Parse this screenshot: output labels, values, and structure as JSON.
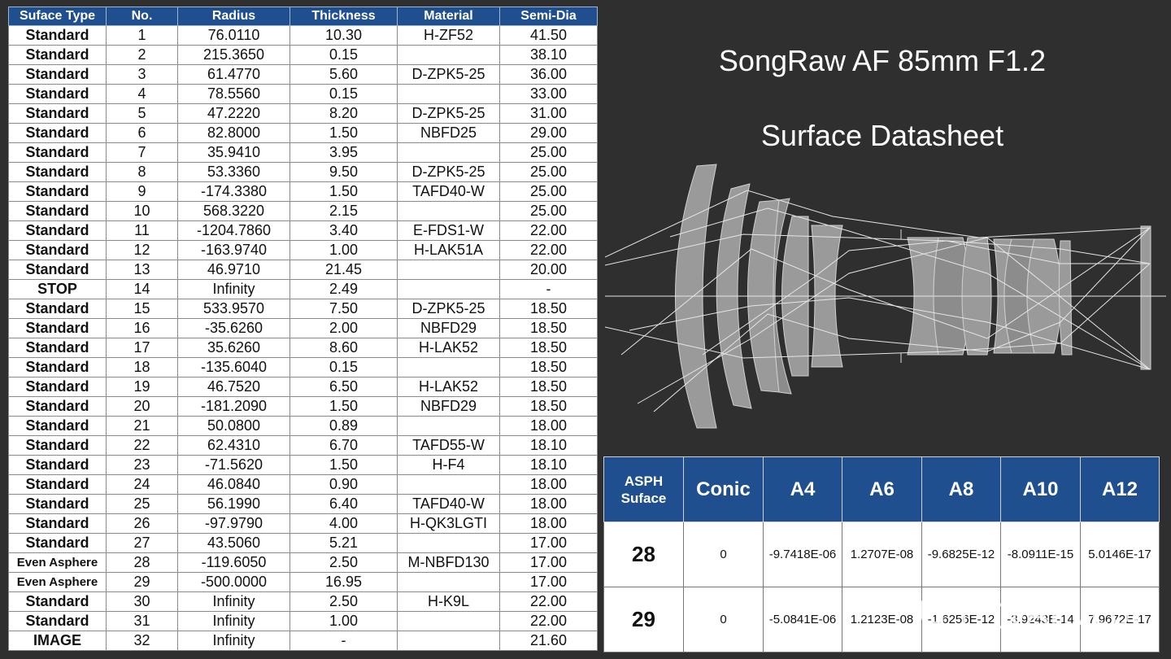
{
  "table": {
    "headers": [
      "Suface Type",
      "No.",
      "Radius",
      "Thickness",
      "Material",
      "Semi-Dia"
    ],
    "rows": [
      [
        "Standard",
        "1",
        "76.0110",
        "10.30",
        "H-ZF52",
        "41.50"
      ],
      [
        "Standard",
        "2",
        "215.3650",
        "0.15",
        "",
        "38.10"
      ],
      [
        "Standard",
        "3",
        "61.4770",
        "5.60",
        "D-ZPK5-25",
        "36.00"
      ],
      [
        "Standard",
        "4",
        "78.5560",
        "0.15",
        "",
        "33.00"
      ],
      [
        "Standard",
        "5",
        "47.2220",
        "8.20",
        "D-ZPK5-25",
        "31.00"
      ],
      [
        "Standard",
        "6",
        "82.8000",
        "1.50",
        "NBFD25",
        "29.00"
      ],
      [
        "Standard",
        "7",
        "35.9410",
        "3.95",
        "",
        "25.00"
      ],
      [
        "Standard",
        "8",
        "53.3360",
        "9.50",
        "D-ZPK5-25",
        "25.00"
      ],
      [
        "Standard",
        "9",
        "-174.3380",
        "1.50",
        "TAFD40-W",
        "25.00"
      ],
      [
        "Standard",
        "10",
        "568.3220",
        "2.15",
        "",
        "25.00"
      ],
      [
        "Standard",
        "11",
        "-1204.7860",
        "3.40",
        "E-FDS1-W",
        "22.00"
      ],
      [
        "Standard",
        "12",
        "-163.9740",
        "1.00",
        "H-LAK51A",
        "22.00"
      ],
      [
        "Standard",
        "13",
        "46.9710",
        "21.45",
        "",
        "20.00"
      ],
      [
        "STOP",
        "14",
        "Infinity",
        "2.49",
        "",
        "-"
      ],
      [
        "Standard",
        "15",
        "533.9570",
        "7.50",
        "D-ZPK5-25",
        "18.50"
      ],
      [
        "Standard",
        "16",
        "-35.6260",
        "2.00",
        "NBFD29",
        "18.50"
      ],
      [
        "Standard",
        "17",
        "35.6260",
        "8.60",
        "H-LAK52",
        "18.50"
      ],
      [
        "Standard",
        "18",
        "-135.6040",
        "0.15",
        "",
        "18.50"
      ],
      [
        "Standard",
        "19",
        "46.7520",
        "6.50",
        "H-LAK52",
        "18.50"
      ],
      [
        "Standard",
        "20",
        "-181.2090",
        "1.50",
        "NBFD29",
        "18.50"
      ],
      [
        "Standard",
        "21",
        "50.0800",
        "0.89",
        "",
        "18.00"
      ],
      [
        "Standard",
        "22",
        "62.4310",
        "6.70",
        "TAFD55-W",
        "18.10"
      ],
      [
        "Standard",
        "23",
        "-71.5620",
        "1.50",
        "H-F4",
        "18.10"
      ],
      [
        "Standard",
        "24",
        "46.0840",
        "0.90",
        "",
        "18.00"
      ],
      [
        "Standard",
        "25",
        "56.1990",
        "6.40",
        "TAFD40-W",
        "18.00"
      ],
      [
        "Standard",
        "26",
        "-97.9790",
        "4.00",
        "H-QK3LGTI",
        "18.00"
      ],
      [
        "Standard",
        "27",
        "43.5060",
        "5.21",
        "",
        "17.00"
      ],
      [
        "Even Asphere",
        "28",
        "-119.6050",
        "2.50",
        "M-NBFD130",
        "17.00"
      ],
      [
        "Even Asphere",
        "29",
        "-500.0000",
        "16.95",
        "",
        "17.00"
      ],
      [
        "Standard",
        "30",
        "Infinity",
        "2.50",
        "H-K9L",
        "22.00"
      ],
      [
        "Standard",
        "31",
        "Infinity",
        "1.00",
        "",
        "22.00"
      ],
      [
        "IMAGE",
        "32",
        "Infinity",
        "-",
        "",
        "21.60"
      ]
    ]
  },
  "title": {
    "line1": "SongRaw AF 85mm F1.2",
    "line2": "Surface Datasheet"
  },
  "asph": {
    "headers": [
      "ASPH Suface",
      "Conic",
      "A4",
      "A6",
      "A8",
      "A10",
      "A12"
    ],
    "rows": [
      [
        "28",
        "0",
        "-9.7418E-06",
        "1.2707E-08",
        "-9.6825E-12",
        "-8.0911E-15",
        "5.0146E-17"
      ],
      [
        "29",
        "0",
        "-5.0841E-06",
        "1.2123E-08",
        "-1.6256E-12",
        "-3.9243E-14",
        "7.9672E-17"
      ]
    ]
  },
  "watermark": "知乎 @Anvcor",
  "colors": {
    "background": "#2f2f2f",
    "header_blue": "#1f4f8f",
    "lens_fill": "#9a9a9a",
    "ray": "#e6e6e6"
  }
}
